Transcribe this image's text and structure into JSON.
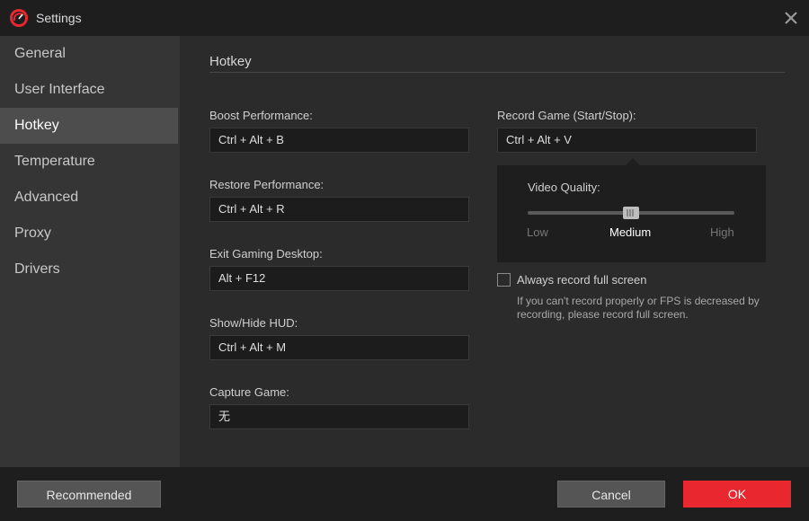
{
  "window": {
    "title": "Settings"
  },
  "sidebar": {
    "items": [
      {
        "label": "General"
      },
      {
        "label": "User Interface"
      },
      {
        "label": "Hotkey"
      },
      {
        "label": "Temperature"
      },
      {
        "label": "Advanced"
      },
      {
        "label": "Proxy"
      },
      {
        "label": "Drivers"
      }
    ],
    "active": "Hotkey"
  },
  "main": {
    "section_title": "Hotkey",
    "left_fields": [
      {
        "label": "Boost Performance:",
        "value": "Ctrl + Alt + B"
      },
      {
        "label": "Restore Performance:",
        "value": "Ctrl + Alt + R"
      },
      {
        "label": "Exit Gaming Desktop:",
        "value": "Alt + F12"
      },
      {
        "label": "Show/Hide HUD:",
        "value": "Ctrl + Alt + M"
      },
      {
        "label": "Capture Game:",
        "value": "无"
      }
    ],
    "record": {
      "label": "Record Game (Start/Stop):",
      "value": "Ctrl + Alt + V"
    },
    "video_quality": {
      "label": "Video Quality:",
      "levels": [
        "Low",
        "Medium",
        "High"
      ],
      "selected": "Medium",
      "selected_index": 1
    },
    "full_screen": {
      "label": "Always record full screen",
      "checked": false,
      "hint": "If you can't record properly or FPS is decreased by recording, please record full screen."
    }
  },
  "footer": {
    "recommended_label": "Recommended",
    "cancel_label": "Cancel",
    "ok_label": "OK"
  },
  "colors": {
    "accent": "#e8282e",
    "sidebar_active": "#4d4d4d"
  },
  "icons": {
    "app": "speedometer-logo-icon",
    "close": "close-icon",
    "slider_grip": "grip-lines-icon"
  }
}
